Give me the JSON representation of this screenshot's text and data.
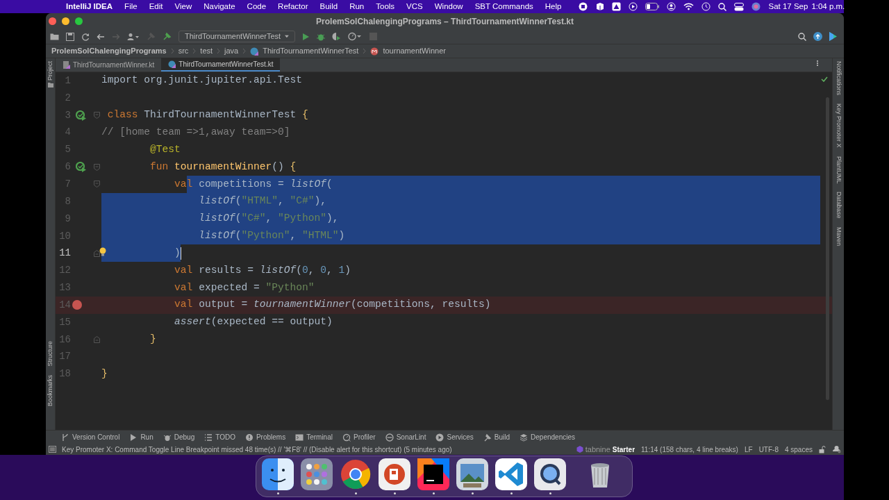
{
  "menubar": {
    "app": "IntelliJ IDEA",
    "menus": [
      "File",
      "Edit",
      "View",
      "Navigate",
      "Code",
      "Refactor",
      "Build",
      "Run",
      "Tools",
      "VCS",
      "Window",
      "SBT Commands",
      "Help"
    ],
    "date": "Sat 17 Sep",
    "time": "1:04 p.m."
  },
  "window": {
    "title": "ProlemSolChalengingPrograms – ThirdTournamentWinnerTest.kt"
  },
  "toolbar": {
    "run_config": "ThirdTournamentWinnerTest"
  },
  "breadcrumbs": [
    {
      "label": "ProlemSolChalengingPrograms",
      "kind": "project"
    },
    {
      "label": "src",
      "kind": "folder"
    },
    {
      "label": "test",
      "kind": "folder"
    },
    {
      "label": "java",
      "kind": "folder"
    },
    {
      "label": "ThirdTournamentWinnerTest",
      "kind": "class"
    },
    {
      "label": "tournamentWinner",
      "kind": "method"
    }
  ],
  "tabs": [
    {
      "label": "ThirdTournamentWinner.kt",
      "selected": false
    },
    {
      "label": "ThirdTournamentWinnerTest.kt",
      "selected": true
    }
  ],
  "left_tools_top": [
    "Project"
  ],
  "left_tools_bottom": [
    "Structure",
    "Bookmarks"
  ],
  "right_tools": [
    "Notifications",
    "Key Promoter X",
    "PlantUML",
    "Database",
    "Maven"
  ],
  "editor": {
    "lines": [
      {
        "number": "1",
        "tokens": [
          {
            "text": "import org.junit.jupiter.api.Test",
            "kind": "plain"
          }
        ]
      },
      {
        "number": "2"
      },
      {
        "number": "3",
        "run": true,
        "fold_start": true,
        "tokens": [
          {
            "text": " class ",
            "kind": "keyword"
          },
          {
            "text": "ThirdTournamentWinnerTest ",
            "kind": "plain"
          },
          {
            "text": "{",
            "kind": "brace"
          }
        ]
      },
      {
        "number": "4",
        "tokens": [
          {
            "text": "// [home team =>1,away team=>0]",
            "kind": "comment"
          }
        ]
      },
      {
        "number": "5",
        "tokens": [
          {
            "text": "        @Test",
            "kind": "annotation"
          }
        ]
      },
      {
        "number": "6",
        "run": true,
        "fold_start": true,
        "tokens": [
          {
            "text": "        fun ",
            "kind": "keyword"
          },
          {
            "text": "tournamentWinner",
            "kind": "function"
          },
          {
            "text": "() ",
            "kind": "plain"
          },
          {
            "text": "{",
            "kind": "brace"
          }
        ]
      },
      {
        "number": "7",
        "fold_start": true,
        "selected_to_end": true,
        "tokens": [
          {
            "text": "            va",
            "kind": "keyword"
          },
          {
            "text": "l ",
            "kind": "keyword",
            "selected": true
          },
          {
            "text": "competitions = ",
            "kind": "plain",
            "selected": true
          },
          {
            "text": "listOf",
            "kind": "call",
            "selected": true
          },
          {
            "text": "(",
            "kind": "plain",
            "selected": true
          }
        ]
      },
      {
        "number": "8",
        "selected_to_end": true,
        "tokens": [
          {
            "text": "                listOf",
            "kind": "call",
            "selected": true
          },
          {
            "text": "(",
            "kind": "plain",
            "selected": true
          },
          {
            "text": "\"HTML\"",
            "kind": "string",
            "selected": true
          },
          {
            "text": ", ",
            "kind": "plain",
            "selected": true
          },
          {
            "text": "\"C#\"",
            "kind": "string",
            "selected": true
          },
          {
            "text": "),",
            "kind": "plain",
            "selected": true
          }
        ]
      },
      {
        "number": "9",
        "selected_to_end": true,
        "tokens": [
          {
            "text": "                listOf",
            "kind": "call",
            "selected": true
          },
          {
            "text": "(",
            "kind": "plain",
            "selected": true
          },
          {
            "text": "\"C#\"",
            "kind": "string",
            "selected": true
          },
          {
            "text": ", ",
            "kind": "plain",
            "selected": true
          },
          {
            "text": "\"Python\"",
            "kind": "string",
            "selected": true
          },
          {
            "text": "),",
            "kind": "plain",
            "selected": true
          }
        ]
      },
      {
        "number": "10",
        "selected_to_end": true,
        "tokens": [
          {
            "text": "                listOf",
            "kind": "call",
            "selected": true
          },
          {
            "text": "(",
            "kind": "plain",
            "selected": true
          },
          {
            "text": "\"Python\"",
            "kind": "string",
            "selected": true
          },
          {
            "text": ", ",
            "kind": "plain",
            "selected": true
          },
          {
            "text": "\"HTML\"",
            "kind": "string",
            "selected": true
          },
          {
            "text": ")",
            "kind": "plain",
            "selected": true
          }
        ]
      },
      {
        "number": "11",
        "bulb": true,
        "fold_end": true,
        "current": true,
        "tokens": [
          {
            "text": "            )",
            "kind": "plain",
            "selected": true
          }
        ]
      },
      {
        "number": "12",
        "tokens": [
          {
            "text": "            val ",
            "kind": "keyword"
          },
          {
            "text": "results = ",
            "kind": "plain"
          },
          {
            "text": "listOf",
            "kind": "call"
          },
          {
            "text": "(",
            "kind": "plain"
          },
          {
            "text": "0",
            "kind": "number"
          },
          {
            "text": ", ",
            "kind": "plain"
          },
          {
            "text": "0",
            "kind": "number"
          },
          {
            "text": ", ",
            "kind": "plain"
          },
          {
            "text": "1",
            "kind": "number"
          },
          {
            "text": ")",
            "kind": "plain"
          }
        ]
      },
      {
        "number": "13",
        "tokens": [
          {
            "text": "            val ",
            "kind": "keyword"
          },
          {
            "text": "expected = ",
            "kind": "plain"
          },
          {
            "text": "\"Python\"",
            "kind": "string"
          }
        ]
      },
      {
        "number": "14",
        "breakpoint": true,
        "tokens": [
          {
            "text": "            val ",
            "kind": "keyword"
          },
          {
            "text": "output = ",
            "kind": "plain"
          },
          {
            "text": "tournamentWinner",
            "kind": "call"
          },
          {
            "text": "(competitions, results)",
            "kind": "plain"
          }
        ]
      },
      {
        "number": "15",
        "tokens": [
          {
            "text": "            assert",
            "kind": "call"
          },
          {
            "text": "(expected == output)",
            "kind": "plain"
          }
        ]
      },
      {
        "number": "16",
        "fold_end": true,
        "tokens": [
          {
            "text": "        }",
            "kind": "brace"
          }
        ]
      },
      {
        "number": "17"
      },
      {
        "number": "18",
        "tokens": [
          {
            "text": "}",
            "kind": "brace"
          }
        ]
      }
    ]
  },
  "tool_windows": [
    {
      "label": "Version Control",
      "kind": "vcs"
    },
    {
      "label": "Run",
      "kind": "run"
    },
    {
      "label": "Debug",
      "kind": "debug"
    },
    {
      "label": "TODO",
      "kind": "list"
    },
    {
      "label": "Problems",
      "kind": "problems"
    },
    {
      "label": "Terminal",
      "kind": "terminal"
    },
    {
      "label": "Profiler",
      "kind": "profiler"
    },
    {
      "label": "SonarLint",
      "kind": "circle"
    },
    {
      "label": "Services",
      "kind": "services"
    },
    {
      "label": "Build",
      "kind": "hammer"
    },
    {
      "label": "Dependencies",
      "kind": "layers"
    }
  ],
  "status_bar": {
    "message": "Key Promoter X: Command Toggle Line Breakpoint missed 48 time(s) // '⌘F8' // (Disable alert for this shortcut) (5 minutes ago)",
    "tabnine": "tabnine",
    "plan": "Starter",
    "items": [
      "11:14 (158 chars, 4 line breaks)",
      "LF",
      "UTF-8",
      "4 spaces"
    ]
  }
}
